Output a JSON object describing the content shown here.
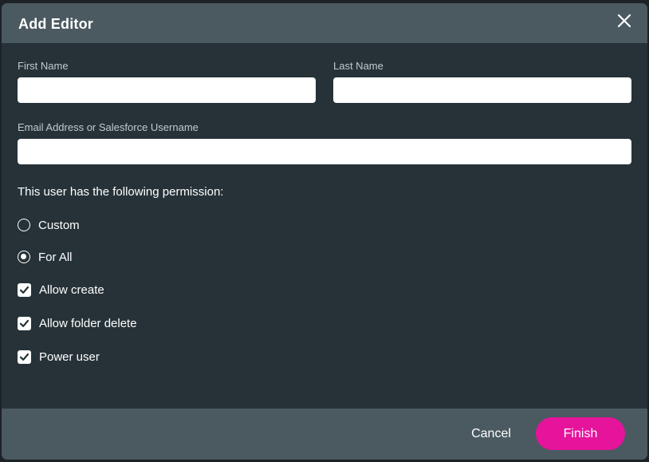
{
  "dialog": {
    "title": "Add Editor",
    "close_icon": "close-icon"
  },
  "form": {
    "first_name": {
      "label": "First Name",
      "value": "",
      "placeholder": ""
    },
    "last_name": {
      "label": "Last Name",
      "value": "",
      "placeholder": ""
    },
    "email": {
      "label": "Email Address or Salesforce Username",
      "value": "",
      "placeholder": ""
    }
  },
  "permissions": {
    "heading": "This user has the following permission:",
    "radios": [
      {
        "label": "Custom",
        "selected": false
      },
      {
        "label": "For All",
        "selected": true
      }
    ],
    "checkboxes": [
      {
        "label": "Allow create",
        "checked": true
      },
      {
        "label": "Allow folder delete",
        "checked": true
      },
      {
        "label": "Power user",
        "checked": true
      }
    ]
  },
  "footer": {
    "cancel_label": "Cancel",
    "finish_label": "Finish"
  },
  "colors": {
    "header_bg": "#4b5a61",
    "body_bg": "#263238",
    "accent": "#e6139b"
  }
}
